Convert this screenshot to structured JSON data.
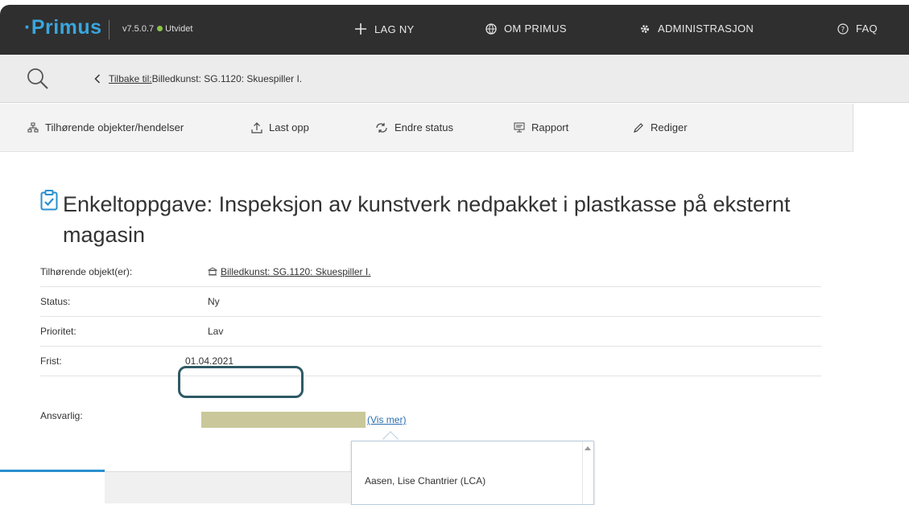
{
  "header": {
    "brand": "Primus",
    "version": "v7.5.0.7",
    "edition": "Utvidet",
    "nav": [
      {
        "label": "LAG NY",
        "icon": "plus-icon"
      },
      {
        "label": "OM PRIMUS",
        "icon": "globe-icon"
      },
      {
        "label": "ADMINISTRASJON",
        "icon": "gear-icon"
      },
      {
        "label": "FAQ",
        "icon": "help-circle-icon"
      }
    ]
  },
  "breadcrumb": {
    "back_prefix": "Tilbake til:",
    "back_target": "Billedkunst: SG.1120: Skuespiller I."
  },
  "toolbar": {
    "items": [
      {
        "label": "Tilhørende objekter/hendelser",
        "icon": "sitemap-icon"
      },
      {
        "label": "Last opp",
        "icon": "upload-icon"
      },
      {
        "label": "Endre status",
        "icon": "status-cycle-icon"
      },
      {
        "label": "Rapport",
        "icon": "report-icon"
      },
      {
        "label": "Rediger",
        "icon": "pencil-icon"
      }
    ]
  },
  "task": {
    "title": "Enkeltoppgave: Inspeksjon av kunstverk nedpakket i plastkasse på eksternt magasin",
    "fields": [
      {
        "label": "Tilhørende objekt(er):",
        "value": "Billedkunst: SG.1120: Skuespiller I."
      },
      {
        "label": "Status:",
        "value": "Ny"
      },
      {
        "label": "Prioritet:",
        "value": "Lav"
      },
      {
        "label": "Frist:",
        "value": "01.04.2021"
      },
      {
        "label": "Ansvarlig:",
        "value": ""
      }
    ],
    "vis_mer": "(Vis mer)"
  },
  "popup": {
    "items": [
      "Aasen, Lise Chantrier (LCA)"
    ]
  },
  "colors": {
    "topbar": "#2f2f2f",
    "brand": "#3aa6dd",
    "highlight": "#2e5a64",
    "redaction": "#cac89a"
  }
}
